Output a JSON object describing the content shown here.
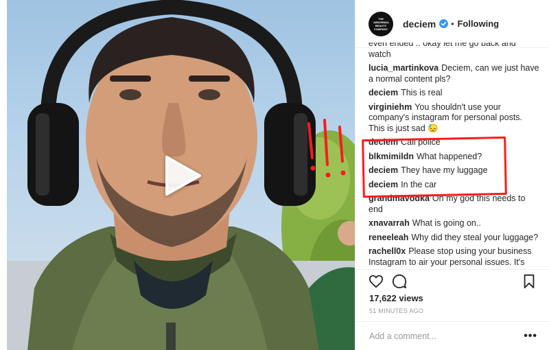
{
  "post": {
    "account": {
      "username": "deciem",
      "avatar_text": "THE ABNORMAL BEAUTY COMPANY",
      "follow_status": "Following",
      "separator": "•"
    },
    "comments": [
      {
        "user": "",
        "text": "even ended .. okay let me go back and watch"
      },
      {
        "user": "lucia_martinkova",
        "text": "Deciem, can we just have a normal content pls?"
      },
      {
        "user": "deciem",
        "text": "This is real"
      },
      {
        "user": "virginiehm",
        "text": "You shouldn't use your company's instagram for personal posts. This is just sad 😓"
      },
      {
        "user": "deciem",
        "text": "Call police"
      },
      {
        "user": "blkmimildn",
        "text": "What happened?"
      },
      {
        "user": "deciem",
        "text": "They have my luggage"
      },
      {
        "user": "deciem",
        "text": "In the car"
      },
      {
        "user": "grandmavodka",
        "text": "Oh my god this needs to end"
      },
      {
        "user": "xnavarrah",
        "text": "What is going on.."
      },
      {
        "user": "reneeleah",
        "text": "Why did they steal your luggage?"
      },
      {
        "user": "rachell0x",
        "text": "Please stop using your business Instagram to air your personal issues. It's"
      }
    ],
    "views": "17,622 views",
    "timestamp": "51 MINUTES AGO",
    "add_comment_placeholder": "Add a comment...",
    "more_label": "•••"
  },
  "annotation": {
    "exclamations": "!!!",
    "color": "#ff1a1a"
  },
  "icons": {
    "verified": "verified-badge-icon",
    "like": "heart-icon",
    "comment": "comment-bubble-icon",
    "save": "bookmark-icon",
    "play": "play-icon"
  },
  "colors": {
    "verified_blue": "#3897f0",
    "text": "#262626",
    "muted": "#999999",
    "border": "#efefef"
  }
}
